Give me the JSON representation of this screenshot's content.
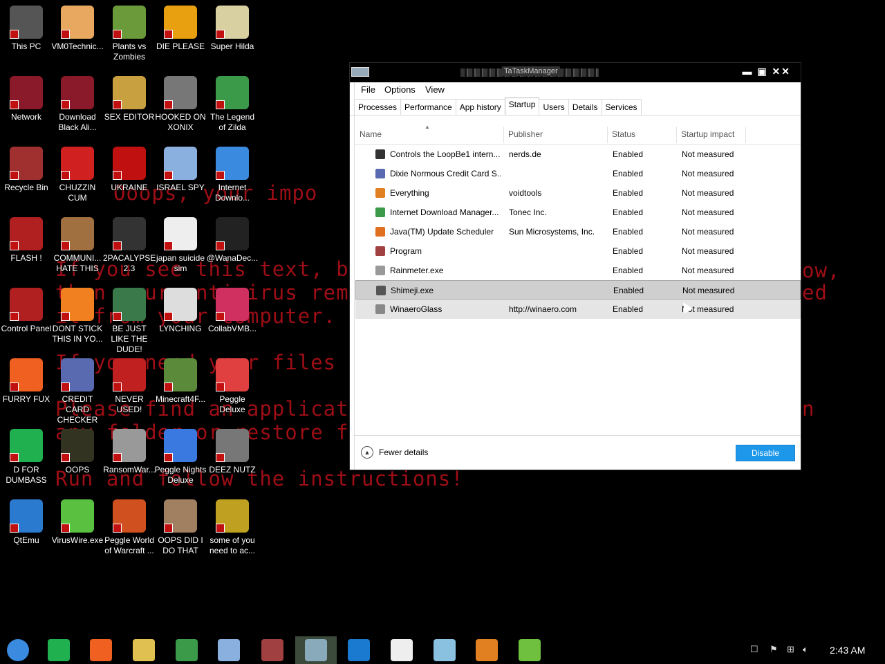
{
  "wallpaper": {
    "lines": [
      "Ooops, your impo",
      "If you see this text, but",
      "then your antivirus remov",
      "it from your computer.",
      "If you need your files y",
      "Please find an applicati",
      "any folder or restore fr",
      "Run and follow the instructions!",
      "ow,",
      "ed",
      "n"
    ]
  },
  "desktop_icons": [
    {
      "label": "This PC",
      "icon": "this-pc-icon",
      "color": "#555"
    },
    {
      "label": "VM0Technic...",
      "icon": "vm0technic-icon",
      "color": "#e8a860"
    },
    {
      "label": "Plants vs Zombies",
      "icon": "plants-vs-zombies-icon",
      "color": "#6a9a3a"
    },
    {
      "label": "DIE PLEASE",
      "icon": "die-please-icon",
      "color": "#e8a010"
    },
    {
      "label": "Super Hilda",
      "icon": "super-hilda-icon",
      "color": "#d8d0a0"
    },
    {
      "label": "Network",
      "icon": "network-icon",
      "color": "#8a1a2a"
    },
    {
      "label": "Download Black Ali...",
      "icon": "download-black-ali-icon",
      "color": "#8a1a2a"
    },
    {
      "label": "SEX EDITOR",
      "icon": "sex-editor-icon",
      "color": "#c8a040"
    },
    {
      "label": "HOOKED ON XONIX",
      "icon": "hooked-on-xonix-icon",
      "color": "#777"
    },
    {
      "label": "The Legend of Zilda",
      "icon": "legend-of-zilda-icon",
      "color": "#3a9a4a"
    },
    {
      "label": "Recycle Bin",
      "icon": "recycle-bin-icon",
      "color": "#a03030"
    },
    {
      "label": "CHUZZIN CUM",
      "icon": "chuzzin-cum-icon",
      "color": "#d02020"
    },
    {
      "label": "UKRAINE",
      "icon": "ukraine-icon",
      "color": "#c01010"
    },
    {
      "label": "ISRAEL SPY",
      "icon": "israel-spy-icon",
      "color": "#8ab0e0"
    },
    {
      "label": "Internet Downlo...",
      "icon": "internet-download-icon",
      "color": "#3a8ae0"
    },
    {
      "label": "FLASH !",
      "icon": "flash-icon",
      "color": "#b02020"
    },
    {
      "label": "COMMUNI... HATE THIS",
      "icon": "communi-icon",
      "color": "#a07040"
    },
    {
      "label": "2PACALYPSE 2.3",
      "icon": "2pacalypse-icon",
      "color": "#333"
    },
    {
      "label": "japan suicide sim",
      "icon": "japan-suicide-sim-icon",
      "color": "#eee"
    },
    {
      "label": "@WanaDec...",
      "icon": "wanadec-icon",
      "color": "#222"
    },
    {
      "label": "Control Panel",
      "icon": "control-panel-icon",
      "color": "#b02020"
    },
    {
      "label": "DONT STICK THIS IN YO...",
      "icon": "dont-stick-icon",
      "color": "#f08020"
    },
    {
      "label": "BE JUST LIKE THE DUDE!",
      "icon": "be-just-like-icon",
      "color": "#3a7a4a"
    },
    {
      "label": "LYNCHING",
      "icon": "lynching-icon",
      "color": "#ddd"
    },
    {
      "label": "CollabVMB...",
      "icon": "collabvm-icon",
      "color": "#d03060"
    },
    {
      "label": "FURRY FUX",
      "icon": "furry-fux-icon",
      "color": "#f06020"
    },
    {
      "label": "CREDIT CARD CHECKER",
      "icon": "credit-card-checker-icon",
      "color": "#5a6ab0"
    },
    {
      "label": "NEVER USED!",
      "icon": "never-used-icon",
      "color": "#c02020"
    },
    {
      "label": "Minecraft4F...",
      "icon": "minecraft-icon",
      "color": "#5a8a3a"
    },
    {
      "label": "Peggle Deluxe",
      "icon": "peggle-deluxe-icon",
      "color": "#e04040"
    },
    {
      "label": "D FOR DUMBASS",
      "icon": "d-for-dumbass-icon",
      "color": "#20b050"
    },
    {
      "label": "OOPS",
      "icon": "oops-icon",
      "color": "#332"
    },
    {
      "label": "RansomWar...",
      "icon": "ransomware-icon",
      "color": "#999"
    },
    {
      "label": "Peggle Nights Deluxe",
      "icon": "peggle-nights-icon",
      "color": "#3a7ae0"
    },
    {
      "label": "DEEZ NUTZ",
      "icon": "deez-nutz-icon",
      "color": "#777"
    },
    {
      "label": "QtEmu",
      "icon": "qtemu-icon",
      "color": "#2a7ad0"
    },
    {
      "label": "VirusWire.exe",
      "icon": "viruswire-icon",
      "color": "#5ac040"
    },
    {
      "label": "Peggle World of Warcraft ...",
      "icon": "peggle-wow-icon",
      "color": "#d05020"
    },
    {
      "label": "OOPS DID I DO THAT",
      "icon": "oops-did-i-icon",
      "color": "#a08060"
    },
    {
      "label": "some of you need to ac...",
      "icon": "some-of-you-icon",
      "color": "#c0a020"
    }
  ],
  "taskmanager": {
    "title": "TaTaskManager",
    "menu": [
      "File",
      "Options",
      "View"
    ],
    "tabs": [
      "Processes",
      "Performance",
      "App history",
      "Startup",
      "Users",
      "Details",
      "Services"
    ],
    "active_tab": "Startup",
    "columns": [
      "Name",
      "Publisher",
      "Status",
      "Startup impact"
    ],
    "rows": [
      {
        "name": "Controls the LoopBe1 intern...",
        "publisher": "nerds.de",
        "status": "Enabled",
        "impact": "Not measured",
        "icon_color": "#333"
      },
      {
        "name": "Dixie Normous Credit Card S...",
        "publisher": "",
        "status": "Enabled",
        "impact": "Not measured",
        "icon_color": "#5a6ab0"
      },
      {
        "name": "Everything",
        "publisher": "voidtools",
        "status": "Enabled",
        "impact": "Not measured",
        "icon_color": "#e08020"
      },
      {
        "name": "Internet Download Manager...",
        "publisher": "Tonec Inc.",
        "status": "Enabled",
        "impact": "Not measured",
        "icon_color": "#3a9a4a"
      },
      {
        "name": "Java(TM) Update Scheduler",
        "publisher": "Sun Microsystems, Inc.",
        "status": "Enabled",
        "impact": "Not measured",
        "icon_color": "#e07020"
      },
      {
        "name": "Program",
        "publisher": "",
        "status": "Enabled",
        "impact": "Not measured",
        "icon_color": "#a04040"
      },
      {
        "name": "Rainmeter.exe",
        "publisher": "",
        "status": "Enabled",
        "impact": "Not measured",
        "icon_color": "#999"
      },
      {
        "name": "Shimeji.exe",
        "publisher": "",
        "status": "Enabled",
        "impact": "Not measured",
        "icon_color": "#555"
      },
      {
        "name": "WinaeroGlass",
        "publisher": "http://winaero.com",
        "status": "Enabled",
        "impact": "Not measured",
        "icon_color": "#888"
      }
    ],
    "selected_row": 7,
    "fewer_details": "Fewer details",
    "disable_button": "Disable"
  },
  "taskbar": {
    "items": [
      {
        "name": "start-button",
        "color": "#3a8ae0"
      },
      {
        "name": "app-green-icon",
        "color": "#20b050"
      },
      {
        "name": "firefox-icon",
        "color": "#f06020"
      },
      {
        "name": "file-explorer-icon",
        "color": "#e0c050"
      },
      {
        "name": "internet-download-manager-icon",
        "color": "#3a9a4a"
      },
      {
        "name": "israel-spy-taskbar-icon",
        "color": "#8ab0e0"
      },
      {
        "name": "portrait-app-icon",
        "color": "#a04040"
      },
      {
        "name": "task-manager-taskbar-icon",
        "color": "#8ab"
      },
      {
        "name": "internet-explorer-icon",
        "color": "#1a7ad0"
      },
      {
        "name": "7zip-icon",
        "color": "#eee"
      },
      {
        "name": "glass-app-icon",
        "color": "#8ac0e0"
      },
      {
        "name": "media-player-icon",
        "color": "#e08020"
      },
      {
        "name": "notepad-icon",
        "color": "#70c040"
      }
    ],
    "clock": "2:43 AM"
  }
}
